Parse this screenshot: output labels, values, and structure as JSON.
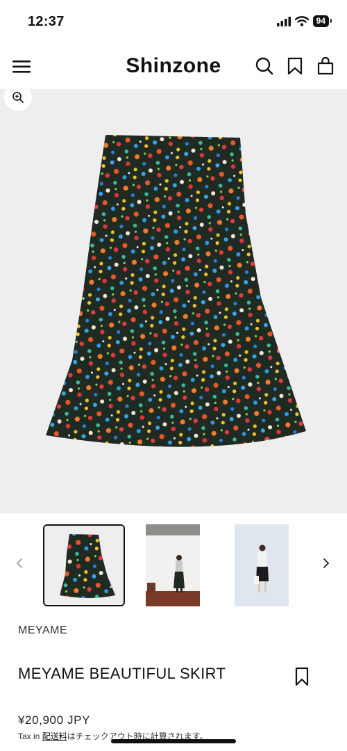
{
  "status": {
    "time": "12:37",
    "battery": "94"
  },
  "header": {
    "brand": "Shinzone"
  },
  "product": {
    "vendor": "MEYAME",
    "title": "MEYAME BEAUTIFUL SKIRT",
    "price": "¥20,900 JPY",
    "tax_prefix": "Tax in ",
    "shipping_link": "配送料",
    "tax_suffix": "はチェックアウト時に計算されます。"
  },
  "colors": {
    "text": "#111111",
    "hero_bg": "#eeeeee",
    "skirt": "#1f2a22"
  },
  "icons": [
    "menu-icon",
    "search-icon",
    "bookmark-icon",
    "bag-icon",
    "zoom-in-icon",
    "chevron-left-icon",
    "chevron-right-icon",
    "signal-icon",
    "wifi-icon"
  ]
}
